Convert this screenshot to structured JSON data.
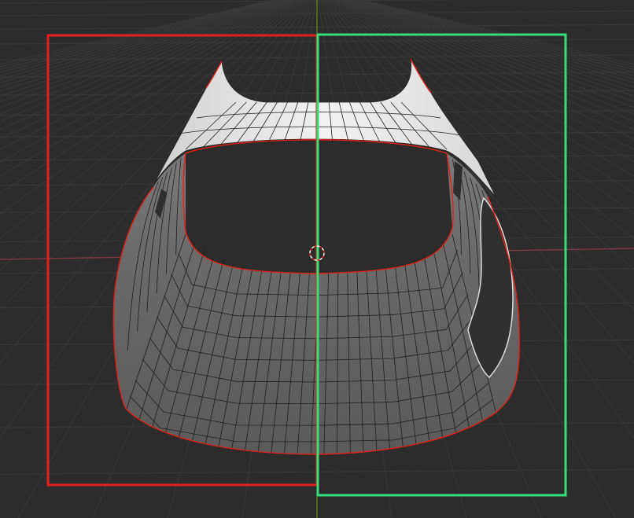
{
  "viewport": {
    "name": "3D Viewport",
    "background": "#2c2c2c",
    "grid_color": "#3b3b3b",
    "x_axis_color": "#8a3a44",
    "y_axis_color": "#6c8a2a",
    "mesh_fill_light": "#e6e6e6",
    "mesh_fill_dark": "#5f5f5f",
    "mesh_wire_color": "#1a1a1a",
    "boundary_edge_color": "#e0211b",
    "selection_box_left_color": "#e41f1f",
    "selection_box_right_color": "#33e07a",
    "cursor_3d_icon": "3d-cursor-icon"
  }
}
